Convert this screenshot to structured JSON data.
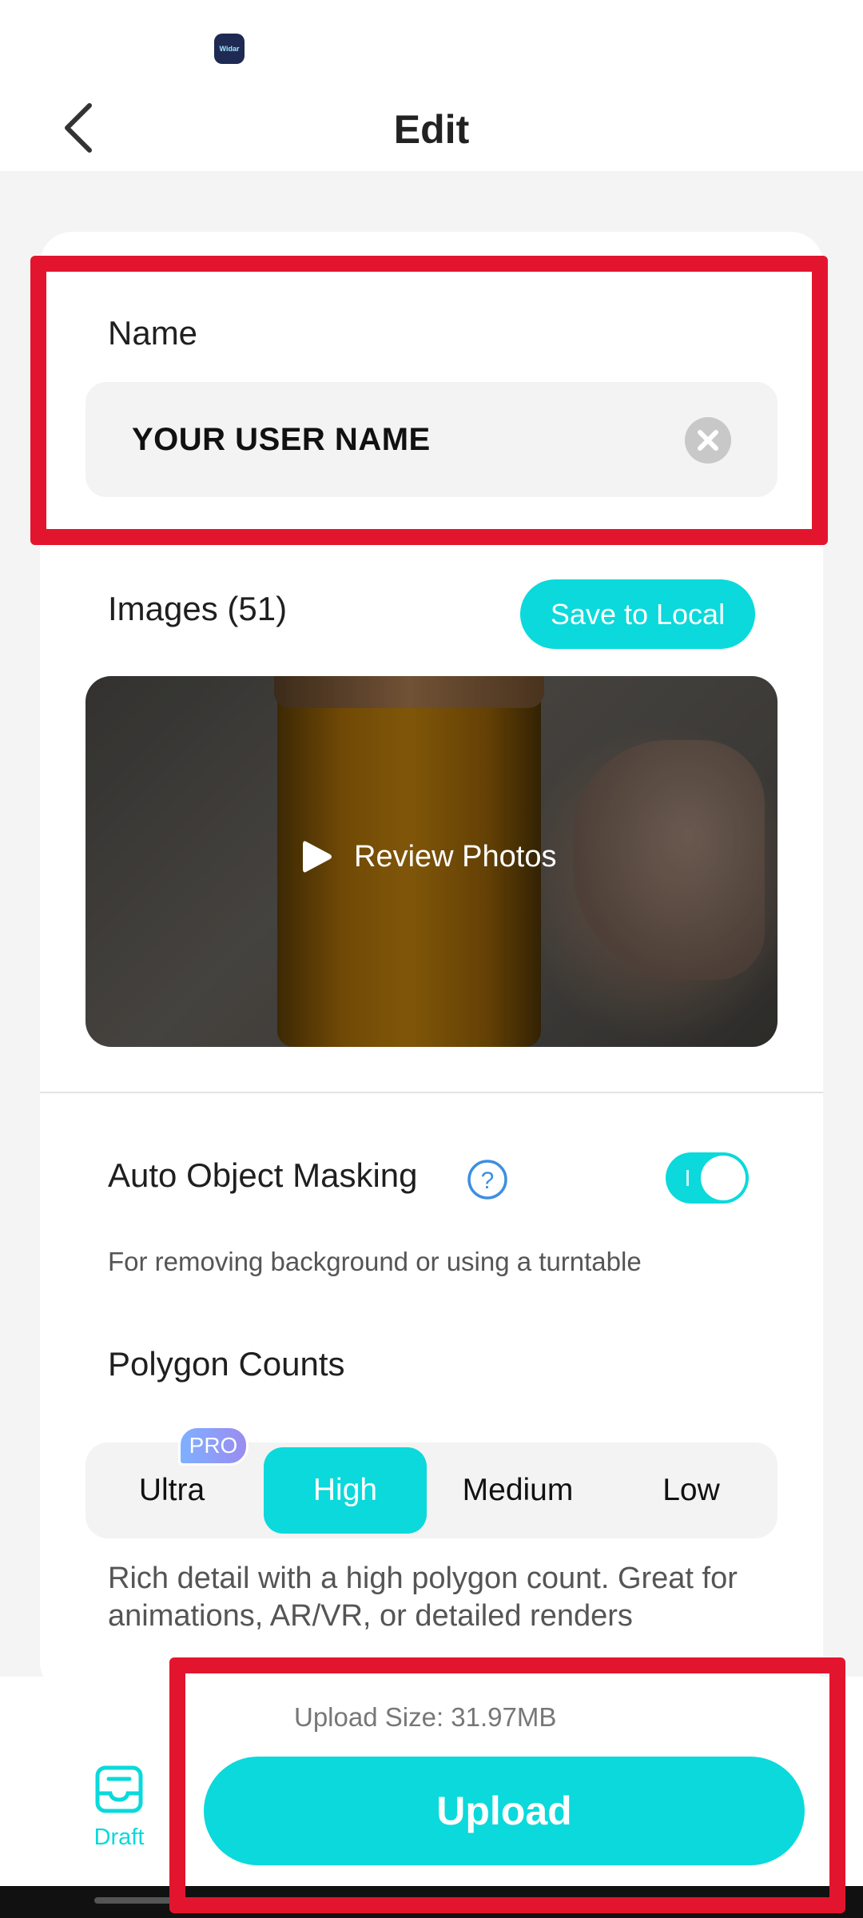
{
  "app_badge_text": "Widar",
  "app_bar": {
    "title": "Edit"
  },
  "name_section": {
    "label": "Name",
    "value": "YOUR USER NAME"
  },
  "images_section": {
    "label": "Images (51)",
    "save_label": "Save to Local",
    "review_label": "Review Photos"
  },
  "masking": {
    "label": "Auto Object Masking",
    "enabled": true,
    "hint": "For removing background or using a turntable"
  },
  "polygon": {
    "label": "Polygon Counts",
    "options": [
      "Ultra",
      "High",
      "Medium",
      "Low"
    ],
    "selected": "High",
    "pro_badge": "PRO",
    "description": "Rich detail with a high polygon count. Great for animations, AR/VR, or detailed renders"
  },
  "bottom": {
    "draft_label": "Draft",
    "upload_size": "Upload Size: 31.97MB",
    "upload_label": "Upload"
  },
  "colors": {
    "accent": "#0bd9db",
    "annotation": "#e3152e",
    "background": "#f4f4f4"
  },
  "icons": [
    "back-arrow-icon",
    "clear-icon",
    "play-icon",
    "help-icon",
    "draft-tray-icon"
  ]
}
